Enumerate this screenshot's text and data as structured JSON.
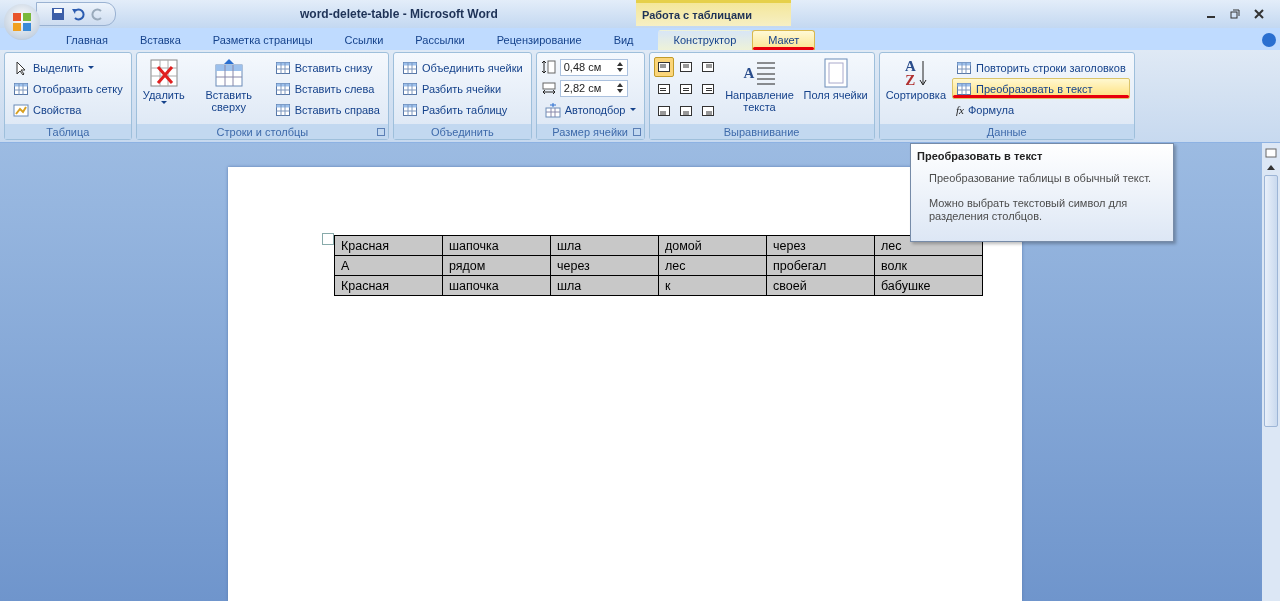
{
  "window": {
    "title": "word-delete-table  -  Microsoft Word",
    "context_title": "Работа с таблицами"
  },
  "tabs": [
    {
      "label": "Главная",
      "selected": false,
      "contextual": false,
      "underlined": false
    },
    {
      "label": "Вставка",
      "selected": false,
      "contextual": false,
      "underlined": false
    },
    {
      "label": "Разметка страницы",
      "selected": false,
      "contextual": false,
      "underlined": false
    },
    {
      "label": "Ссылки",
      "selected": false,
      "contextual": false,
      "underlined": false
    },
    {
      "label": "Рассылки",
      "selected": false,
      "contextual": false,
      "underlined": false
    },
    {
      "label": "Рецензирование",
      "selected": false,
      "contextual": false,
      "underlined": false
    },
    {
      "label": "Вид",
      "selected": false,
      "contextual": false,
      "underlined": false
    },
    {
      "label": "Конструктор",
      "selected": false,
      "contextual": true,
      "underlined": false
    },
    {
      "label": "Макет",
      "selected": true,
      "contextual": true,
      "underlined": true
    }
  ],
  "groups": [
    {
      "label": "Таблица",
      "launcher": false,
      "items": [
        {
          "kind": "small",
          "label": "Выделить",
          "caret": true,
          "highlighted": false,
          "underlined": false
        },
        {
          "kind": "small",
          "label": "Отобразить сетку",
          "caret": false,
          "highlighted": false,
          "underlined": false
        },
        {
          "kind": "small",
          "label": "Свойства",
          "caret": false,
          "highlighted": false,
          "underlined": false
        }
      ]
    },
    {
      "label": "Строки и столбцы",
      "launcher": true,
      "items": [
        {
          "kind": "large",
          "label": "Удалить",
          "caret": true
        },
        {
          "kind": "large",
          "label": "Вставить сверху",
          "caret": false
        },
        {
          "kind": "small",
          "label": "Вставить снизу",
          "caret": false,
          "highlighted": false,
          "underlined": false
        },
        {
          "kind": "small",
          "label": "Вставить слева",
          "caret": false,
          "highlighted": false,
          "underlined": false
        },
        {
          "kind": "small",
          "label": "Вставить справа",
          "caret": false,
          "highlighted": false,
          "underlined": false
        }
      ]
    },
    {
      "label": "Объединить",
      "launcher": false,
      "items": [
        {
          "kind": "small",
          "label": "Объединить ячейки",
          "caret": false,
          "highlighted": false,
          "underlined": false
        },
        {
          "kind": "small",
          "label": "Разбить ячейки",
          "caret": false,
          "highlighted": false,
          "underlined": false
        },
        {
          "kind": "small",
          "label": "Разбить таблицу",
          "caret": false,
          "highlighted": false,
          "underlined": false
        }
      ]
    },
    {
      "label": "Размер ячейки",
      "launcher": true,
      "items": [
        {
          "kind": "spin",
          "value": "0,48 см"
        },
        {
          "kind": "spin",
          "value": "2,82 см"
        },
        {
          "kind": "small",
          "label": "Автоподбор",
          "caret": true,
          "highlighted": false,
          "underlined": false
        }
      ]
    },
    {
      "label": "Выравнивание",
      "launcher": false,
      "items": [
        {
          "kind": "align",
          "cells": [
            {
              "selected": true
            },
            {
              "selected": false
            },
            {
              "selected": false
            },
            {
              "selected": false
            },
            {
              "selected": false
            },
            {
              "selected": false
            },
            {
              "selected": false
            },
            {
              "selected": false
            },
            {
              "selected": false
            }
          ]
        },
        {
          "kind": "large",
          "label": "Направление текста",
          "caret": false,
          "icon_letters": [
            "A"
          ]
        },
        {
          "kind": "large",
          "label": "Поля ячейки",
          "caret": false
        }
      ]
    },
    {
      "label": "Данные",
      "launcher": false,
      "items": [
        {
          "kind": "large",
          "label": "Сортировка",
          "caret": false,
          "icon_letters": [
            "A",
            "Z"
          ]
        },
        {
          "kind": "small",
          "label": "Повторить строки заголовков",
          "caret": false,
          "highlighted": false,
          "underlined": false
        },
        {
          "kind": "small",
          "label": "Преобразовать в текст",
          "caret": false,
          "highlighted": true,
          "underlined": true
        },
        {
          "kind": "small",
          "label": "Формула",
          "caret": false,
          "highlighted": false,
          "underlined": false,
          "icon_letters": [
            "fx"
          ]
        }
      ]
    }
  ],
  "tooltip": {
    "title": "Преобразовать в текст",
    "paragraphs": [
      "Преобразование таблицы в обычный текст.",
      "Можно выбрать текстовый символ для разделения столбцов."
    ]
  },
  "table": {
    "rows": [
      [
        "Красная",
        "шапочка",
        "шла",
        "домой",
        "через",
        "лес"
      ],
      [
        "А",
        "рядом",
        "через",
        "лес",
        "пробегал",
        "волк"
      ],
      [
        "Красная",
        "шапочка",
        "шла",
        "к",
        "своей",
        "бабушке"
      ]
    ]
  }
}
